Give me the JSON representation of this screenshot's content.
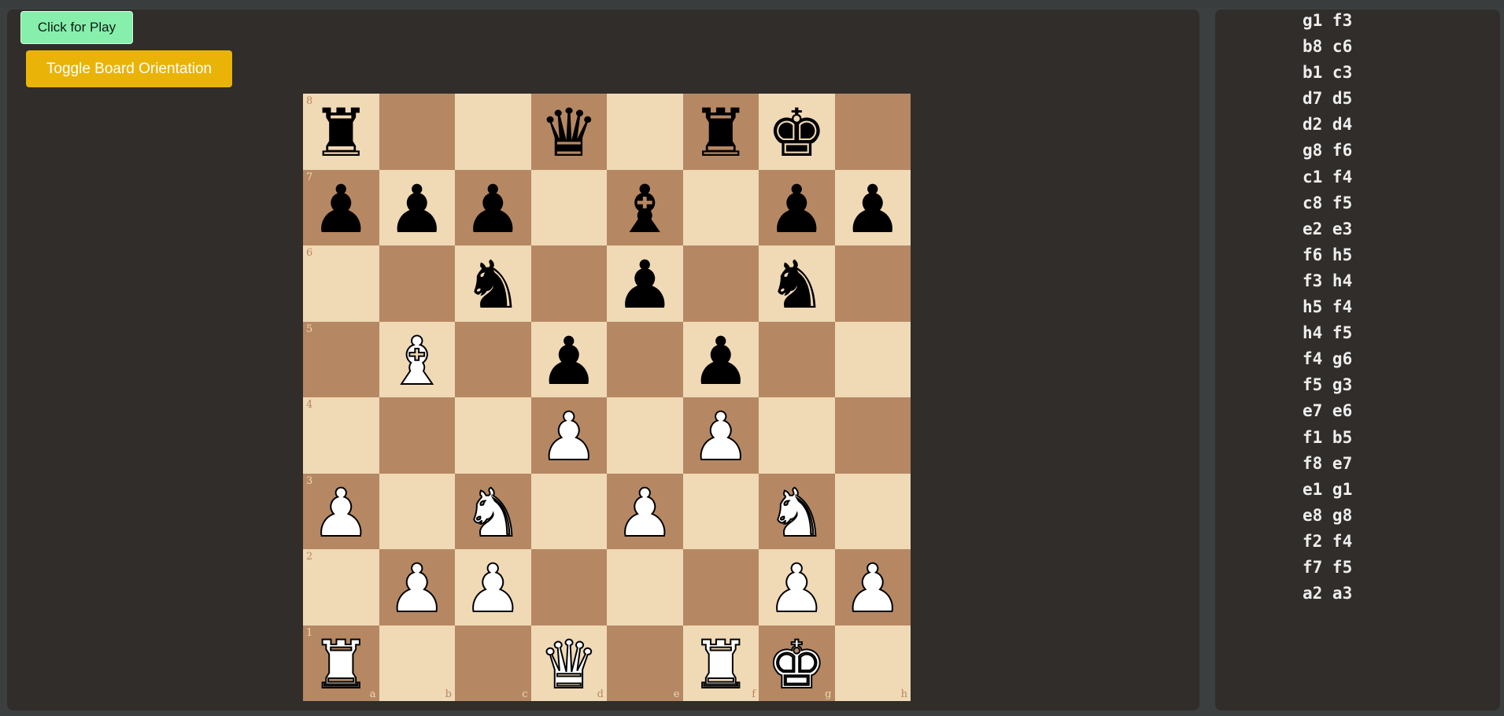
{
  "controls": {
    "play_label": "Click for Play",
    "toggle_label": "Toggle Board Orientation"
  },
  "board": {
    "ranks": [
      "8",
      "7",
      "6",
      "5",
      "4",
      "3",
      "2",
      "1"
    ],
    "files": [
      "a",
      "b",
      "c",
      "d",
      "e",
      "f",
      "g",
      "h"
    ],
    "colors": {
      "light": "#f0d9b5",
      "dark": "#b58863"
    },
    "position": [
      [
        "br",
        "",
        "",
        "bq",
        "",
        "br",
        "bk",
        ""
      ],
      [
        "bp",
        "bp",
        "bp",
        "",
        "bb",
        "",
        "bp",
        "bp"
      ],
      [
        "",
        "",
        "bn",
        "",
        "bp",
        "",
        "bn",
        ""
      ],
      [
        "",
        "wb",
        "",
        "bp",
        "",
        "bp",
        "",
        ""
      ],
      [
        "",
        "",
        "",
        "wp",
        "",
        "wp",
        "",
        ""
      ],
      [
        "wp",
        "",
        "wn",
        "",
        "wp",
        "",
        "wn",
        ""
      ],
      [
        "",
        "wp",
        "wp",
        "",
        "",
        "",
        "wp",
        "wp"
      ],
      [
        "wr",
        "",
        "",
        "wq",
        "",
        "wr",
        "wk",
        ""
      ]
    ]
  },
  "moves": [
    "g1 f3",
    "b8 c6",
    "b1 c3",
    "d7 d5",
    "d2 d4",
    "g8 f6",
    "c1 f4",
    "c8 f5",
    "e2 e3",
    "f6 h5",
    "f3 h4",
    "h5 f4",
    "h4 f5",
    "f4 g6",
    "f5 g3",
    "e7 e6",
    "f1 b5",
    "f8 e7",
    "e1 g1",
    "e8 g8",
    "f2 f4",
    "f7 f5",
    "a2 a3"
  ]
}
